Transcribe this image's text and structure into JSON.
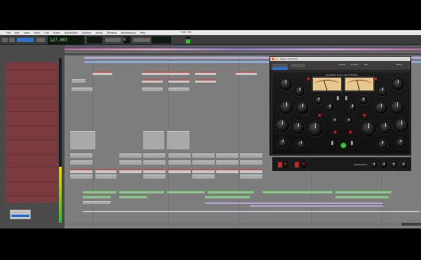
{
  "menubar": {
    "apple_icon": "apple-icon",
    "items": [
      "File",
      "Edit",
      "View",
      "Track",
      "Clip",
      "Event",
      "AudioSuite",
      "Options",
      "Setup",
      "Window",
      "Marketplace",
      "Help"
    ],
    "window_title": "Edit: Mix"
  },
  "transport": {
    "main_counter": "127.007",
    "secondary_counter": "0",
    "cpu_label": "CPU"
  },
  "plugin": {
    "window_title": "Plug-in: Fairchild",
    "name": "SHADOW HILLS MASTERING",
    "brand": "BRAINWORX",
    "left_readout": "0",
    "right_readout": "0",
    "header_buttons": [
      "Bypass",
      "Compare",
      "Auto",
      "Native"
    ],
    "power_state": "on"
  },
  "colors": {
    "track_header": "#7a3a3e",
    "edit_bg": "#7d7d7d",
    "clip_red": "#b85a5a",
    "clip_green": "#62a862",
    "meter_green": "#2fbf2f",
    "vu_face": "#e8c78a",
    "led_red": "#e02020"
  }
}
